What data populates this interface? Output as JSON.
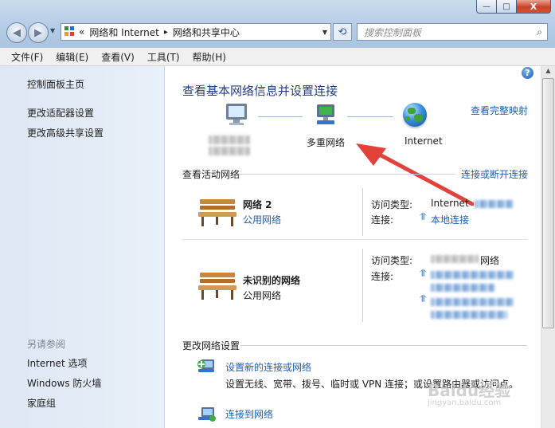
{
  "window": {
    "minimize": "—",
    "maximize": "□",
    "close": "X"
  },
  "address": {
    "prefix": "«",
    "crumb1": "网络和 Internet",
    "sep": "▸",
    "crumb2": "网络和共享中心"
  },
  "search": {
    "placeholder": "搜索控制面板"
  },
  "menu": [
    "文件(F)",
    "编辑(E)",
    "查看(V)",
    "工具(T)",
    "帮助(H)"
  ],
  "left_pane": {
    "home": "控制面板主页",
    "links": [
      "更改适配器设置",
      "更改高级共享设置"
    ],
    "see_also_title": "另请参阅",
    "see_also": [
      "Internet 选项",
      "Windows 防火墙",
      "家庭组"
    ]
  },
  "main": {
    "title": "查看基本网络信息并设置连接",
    "view_full_map": "查看完整映射",
    "map_nodes": [
      "多重网络",
      "Internet"
    ],
    "active_networks_title": "查看活动网络",
    "connect_disconnect": "连接或断开连接",
    "networks": [
      {
        "name": "网络  2",
        "type": "公用网络",
        "access_label": "访问类型:",
        "access_value": "Internet",
        "connection_label": "连接:",
        "connection_value": "本地连接"
      },
      {
        "name": "未识别的网络",
        "type": "公用网络",
        "access_label": "访问类型:",
        "access_value": "网络",
        "connection_label": "连接:"
      }
    ],
    "change_settings_title": "更改网络设置",
    "tasks": [
      {
        "title": "设置新的连接或网络",
        "desc": "设置无线、宽带、拨号、临时或 VPN 连接；或设置路由器或访问点。"
      },
      {
        "title": "连接到网络",
        "desc": ""
      }
    ]
  },
  "watermark": {
    "logo": "Baidu经验",
    "url": "jingyan.baidu.com"
  },
  "colors": {
    "link": "#1f5fb0",
    "title": "#1d3f8a",
    "arrow": "#e2423a"
  }
}
